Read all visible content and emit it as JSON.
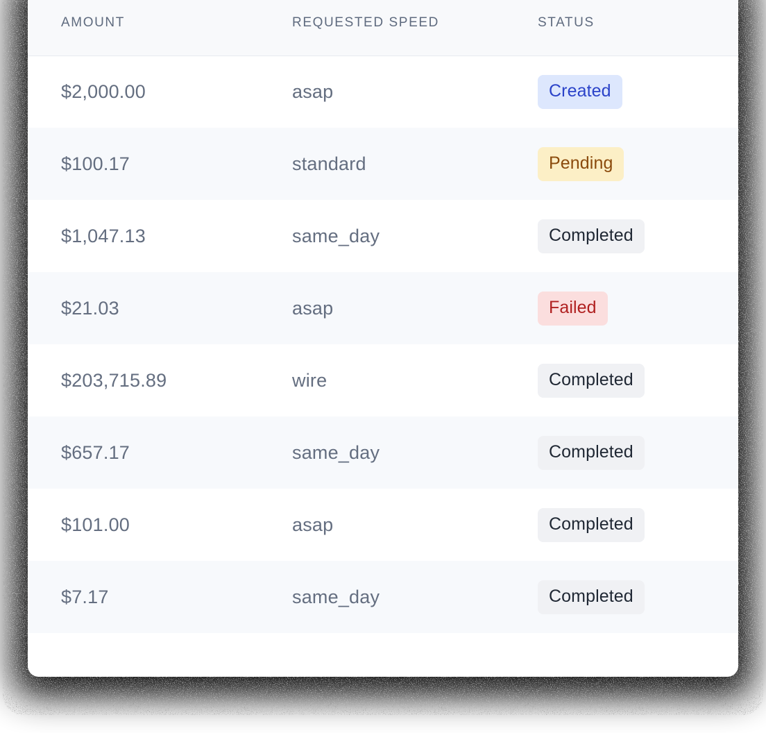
{
  "table": {
    "columns": [
      {
        "key": "amount",
        "label": "AMOUNT"
      },
      {
        "key": "speed",
        "label": "REQUESTED SPEED"
      },
      {
        "key": "status",
        "label": "STATUS"
      }
    ],
    "rows": [
      {
        "amount": "$2,000.00",
        "speed": "asap",
        "status": "Created",
        "status_variant": "created"
      },
      {
        "amount": "$100.17",
        "speed": "standard",
        "status": "Pending",
        "status_variant": "pending"
      },
      {
        "amount": "$1,047.13",
        "speed": "same_day",
        "status": "Completed",
        "status_variant": "completed"
      },
      {
        "amount": "$21.03",
        "speed": "asap",
        "status": "Failed",
        "status_variant": "failed"
      },
      {
        "amount": "$203,715.89",
        "speed": "wire",
        "status": "Completed",
        "status_variant": "completed"
      },
      {
        "amount": "$657.17",
        "speed": "same_day",
        "status": "Completed",
        "status_variant": "completed"
      },
      {
        "amount": "$101.00",
        "speed": "asap",
        "status": "Completed",
        "status_variant": "completed"
      },
      {
        "amount": "$7.17",
        "speed": "same_day",
        "status": "Completed",
        "status_variant": "completed"
      }
    ]
  },
  "colors": {
    "card_background": "#FFFFFF",
    "header_background": "#F8F9FB",
    "header_text": "#5F6B7F",
    "row_alt_background": "#F7F9FC",
    "cell_text": "#646E80",
    "divider": "#E7EAF0",
    "badge_created_bg": "#DDE7FD",
    "badge_created_text": "#2B43C9",
    "badge_pending_bg": "#FCEFC6",
    "badge_pending_text": "#8B4B0D",
    "badge_completed_bg": "#F0F1F4",
    "badge_completed_text": "#1F2733",
    "badge_failed_bg": "#FBDEDE",
    "badge_failed_text": "#B02020"
  }
}
